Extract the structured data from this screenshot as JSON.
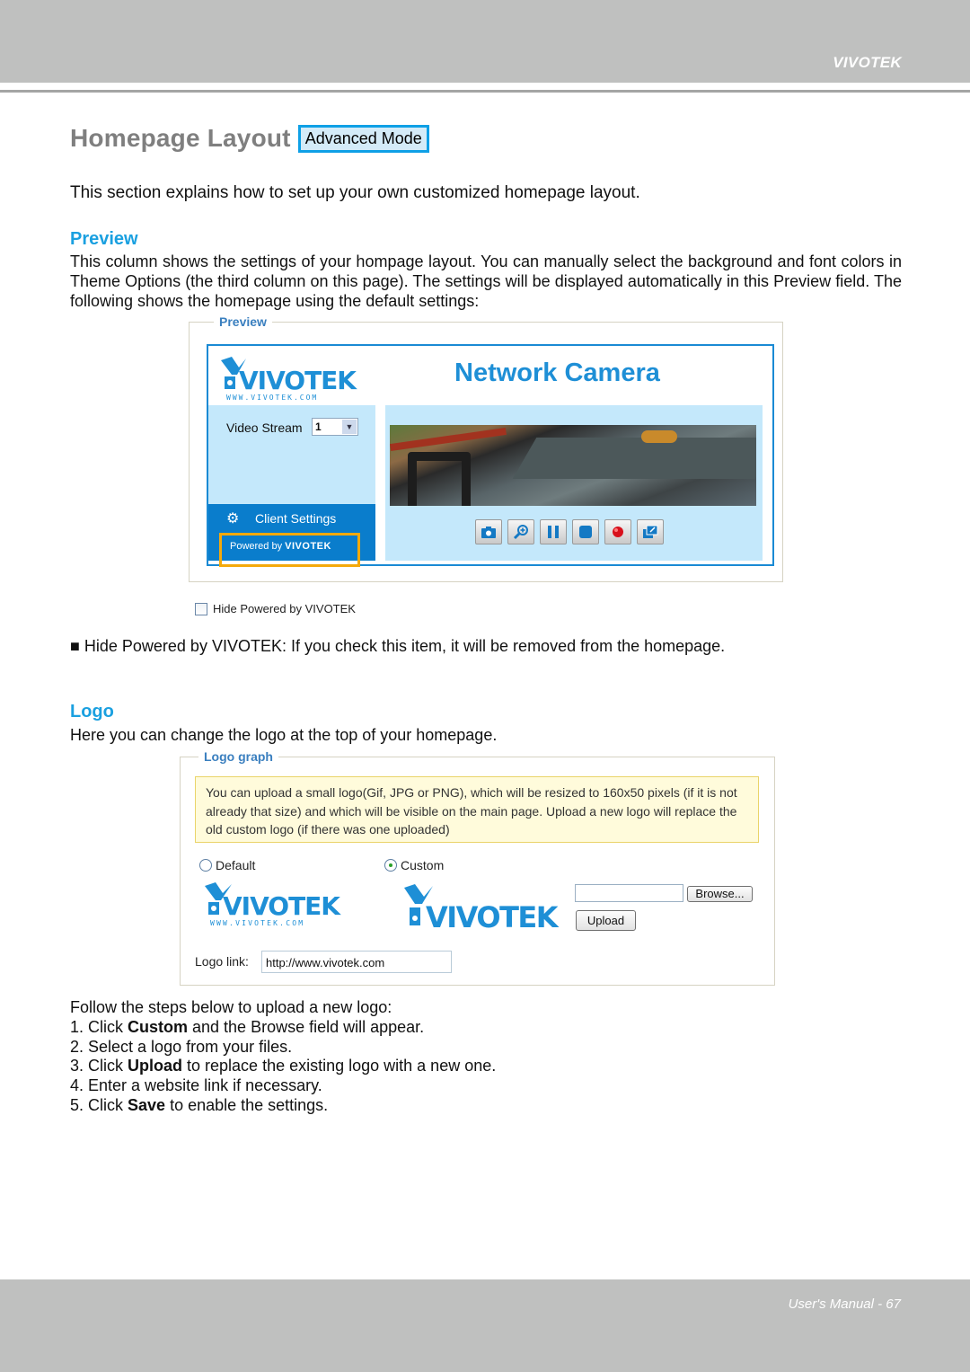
{
  "header": {
    "brand": "VIVOTEK"
  },
  "title": {
    "text": "Homepage Layout",
    "badge": "Advanced Mode"
  },
  "intro": "This section explains how to set up your own customized homepage layout.",
  "preview_section": {
    "heading": "Preview",
    "paragraph": "This column shows the settings of your hompage layout. You can manually select the background and font colors in Theme Options (the third column on this page). The settings will be displayed automatically in this Preview field. The following shows the homepage using the default settings:",
    "screenshot": {
      "legend": "Preview",
      "logo_text": "VIVOTEK",
      "logo_url_text": "WWW.VIVOTEK.COM",
      "page_title": "Network Camera",
      "video_stream_label": "Video Stream",
      "video_stream_value": "1",
      "client_settings_label": "Client Settings",
      "powered_by_label": "Powered by",
      "powered_by_brand": "VIVOTEK",
      "controls": [
        "snapshot-icon",
        "digital-zoom-icon",
        "pause-icon",
        "stop-icon",
        "record-icon",
        "fullscreen-icon"
      ],
      "colors": {
        "frame": "#1a8ad4",
        "panel": "#c4e8fb",
        "client_bar": "#0a7dcc",
        "highlight": "#f4a90b",
        "title": "#1e8fd6"
      }
    },
    "hide_powered_checkbox": {
      "label": "Hide Powered by VIVOTEK",
      "checked": false
    },
    "bullet": "■ Hide Powered by VIVOTEK: If you check this item, it will be removed from the homepage."
  },
  "logo_section": {
    "heading": "Logo",
    "paragraph": "Here you can change the logo at the top of your homepage.",
    "screenshot": {
      "legend": "Logo graph",
      "note": "You can upload a small logo(Gif, JPG or PNG), which will be resized to 160x50 pixels (if it is not already that size) and which will be visible on the main page. Upload a new logo will replace the old custom logo (if there was one uploaded)",
      "radio_default": {
        "label": "Default",
        "selected": false
      },
      "radio_custom": {
        "label": "Custom",
        "selected": true
      },
      "default_logo_text": "VIVOTEK",
      "default_logo_url": "WWW.VIVOTEK.COM",
      "custom_logo_text": "VIVOTEK",
      "file_input_value": "",
      "browse_label": "Browse...",
      "upload_label": "Upload",
      "logo_link_label": "Logo link:",
      "logo_link_value": "http://www.vivotek.com"
    },
    "steps_intro": "Follow the steps below to upload a new logo:",
    "steps": [
      {
        "pre": "1. Click ",
        "bold": "Custom",
        "post": " and the Browse field will appear."
      },
      {
        "pre": "2. Select a logo from your files.",
        "bold": "",
        "post": ""
      },
      {
        "pre": "3. Click ",
        "bold": "Upload",
        "post": " to replace the existing logo with a new one."
      },
      {
        "pre": "4. Enter a website link if necessary.",
        "bold": "",
        "post": ""
      },
      {
        "pre": "5. Click ",
        "bold": "Save",
        "post": " to enable the settings."
      }
    ]
  },
  "footer": {
    "text": "User's Manual - 67"
  },
  "colors": {
    "accent": "#1aa0e0",
    "band": "#bfc0bf",
    "title_gray": "#7f7f7f",
    "badge_border": "#0ea0e6"
  }
}
